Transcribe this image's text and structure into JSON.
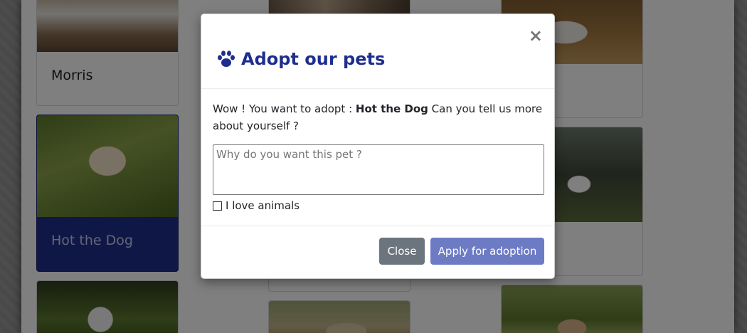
{
  "cards": {
    "morris": {
      "name": "Morris"
    },
    "hot_dog": {
      "name": "Hot the Dog"
    }
  },
  "modal": {
    "title": "Adopt our pets",
    "close_icon": "×",
    "intro_prefix": "Wow ! You want to adopt : ",
    "pet_name": "Hot the Dog",
    "intro_suffix": " Can you tell us more about yourself ?",
    "reason_placeholder": "Why do you want this pet ?",
    "checkbox_label": "I love animals",
    "close_button": "Close",
    "apply_button": "Apply for adoption"
  },
  "colors": {
    "brand": "#1d2e8e",
    "selected_card": "#1f2f8f",
    "close_button": "#6c757d",
    "apply_button": "#6c7bc4"
  }
}
